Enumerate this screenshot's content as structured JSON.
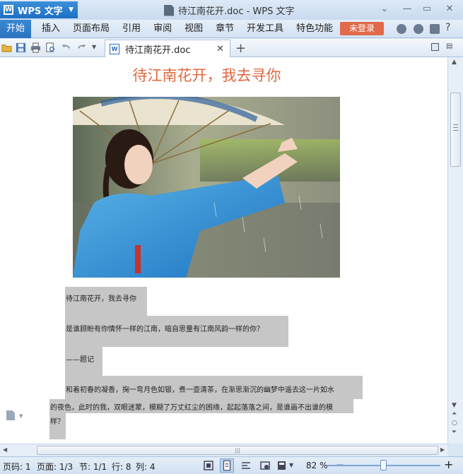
{
  "app": {
    "button_label": "WPS 文字",
    "window_title": "待江南花开.doc - WPS 文字"
  },
  "menu": {
    "items": [
      "开始",
      "插入",
      "页面布局",
      "引用",
      "审阅",
      "视图",
      "章节",
      "开发工具",
      "特色功能"
    ],
    "login_label": "未登录",
    "help_label": "?"
  },
  "tab": {
    "filename": "待江南花开.doc"
  },
  "document": {
    "heading": "待江南花开，我去寻你",
    "paragraphs": [
      "待江南花开，我去寻你",
      "是谁顾盼有你情怀一样的江南，暗自思量有江南风韵一样的你？",
      "——题记",
      "和着初春的凝香，掬一弯月色如银，煮一壶清茶，在渐思渐沉的幽梦中遥去这一片如水",
      "的夜色，此时的我，双眼迷蒙，模糊了万丈红尘的困缘，起起落落之间，是谁画不出谁的模",
      "样？"
    ]
  },
  "status": {
    "page_code": "页码: 1",
    "page": "页面: 1/3",
    "section": "节: 1/1",
    "row": "行: 8",
    "col": "列: 4",
    "zoom": "82 %"
  },
  "colors": {
    "accent": "#2a73bf",
    "heading": "#e0683f",
    "login": "#e06a4a"
  }
}
